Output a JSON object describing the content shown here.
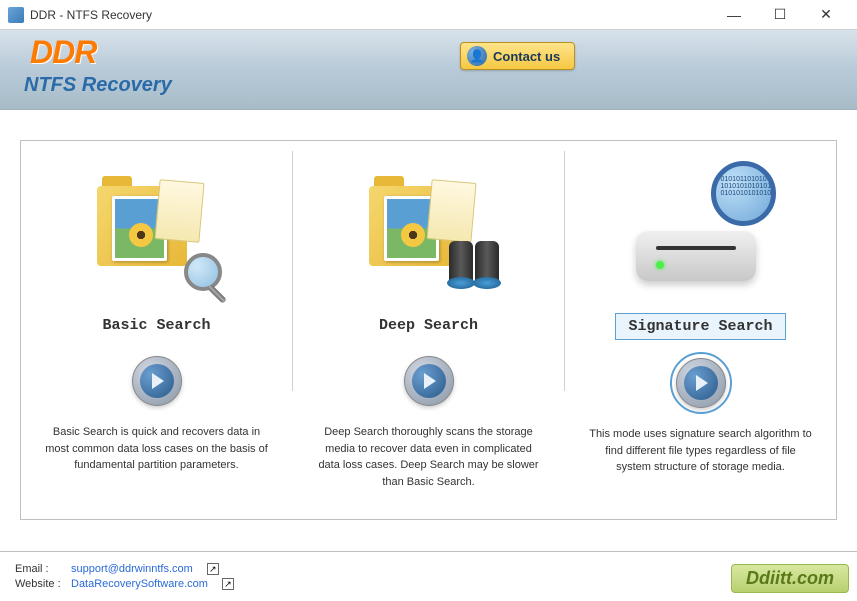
{
  "window": {
    "title": "DDR - NTFS Recovery"
  },
  "header": {
    "logo_text": "DDR",
    "subtitle": "NTFS Recovery",
    "contact_label": "Contact us"
  },
  "modes": [
    {
      "title": "Basic Search",
      "description": "Basic Search is quick and recovers data in most common data loss cases on the basis of fundamental partition parameters.",
      "selected": false,
      "icon": "folder-magnifier"
    },
    {
      "title": "Deep Search",
      "description": "Deep Search thoroughly scans the storage media to recover data even in complicated data loss cases. Deep Search may be slower than Basic Search.",
      "selected": false,
      "icon": "folder-binoculars"
    },
    {
      "title": "Signature Search",
      "description": "This mode uses signature search algorithm to find different file types regardless of file system structure of storage media.",
      "selected": true,
      "icon": "drive-magnifier"
    }
  ],
  "footer": {
    "email_label": "Email :",
    "email": "support@ddrwinntfs.com",
    "website_label": "Website :",
    "website": "DataRecoverySoftware.com",
    "watermark": "Ddiitt.com"
  }
}
